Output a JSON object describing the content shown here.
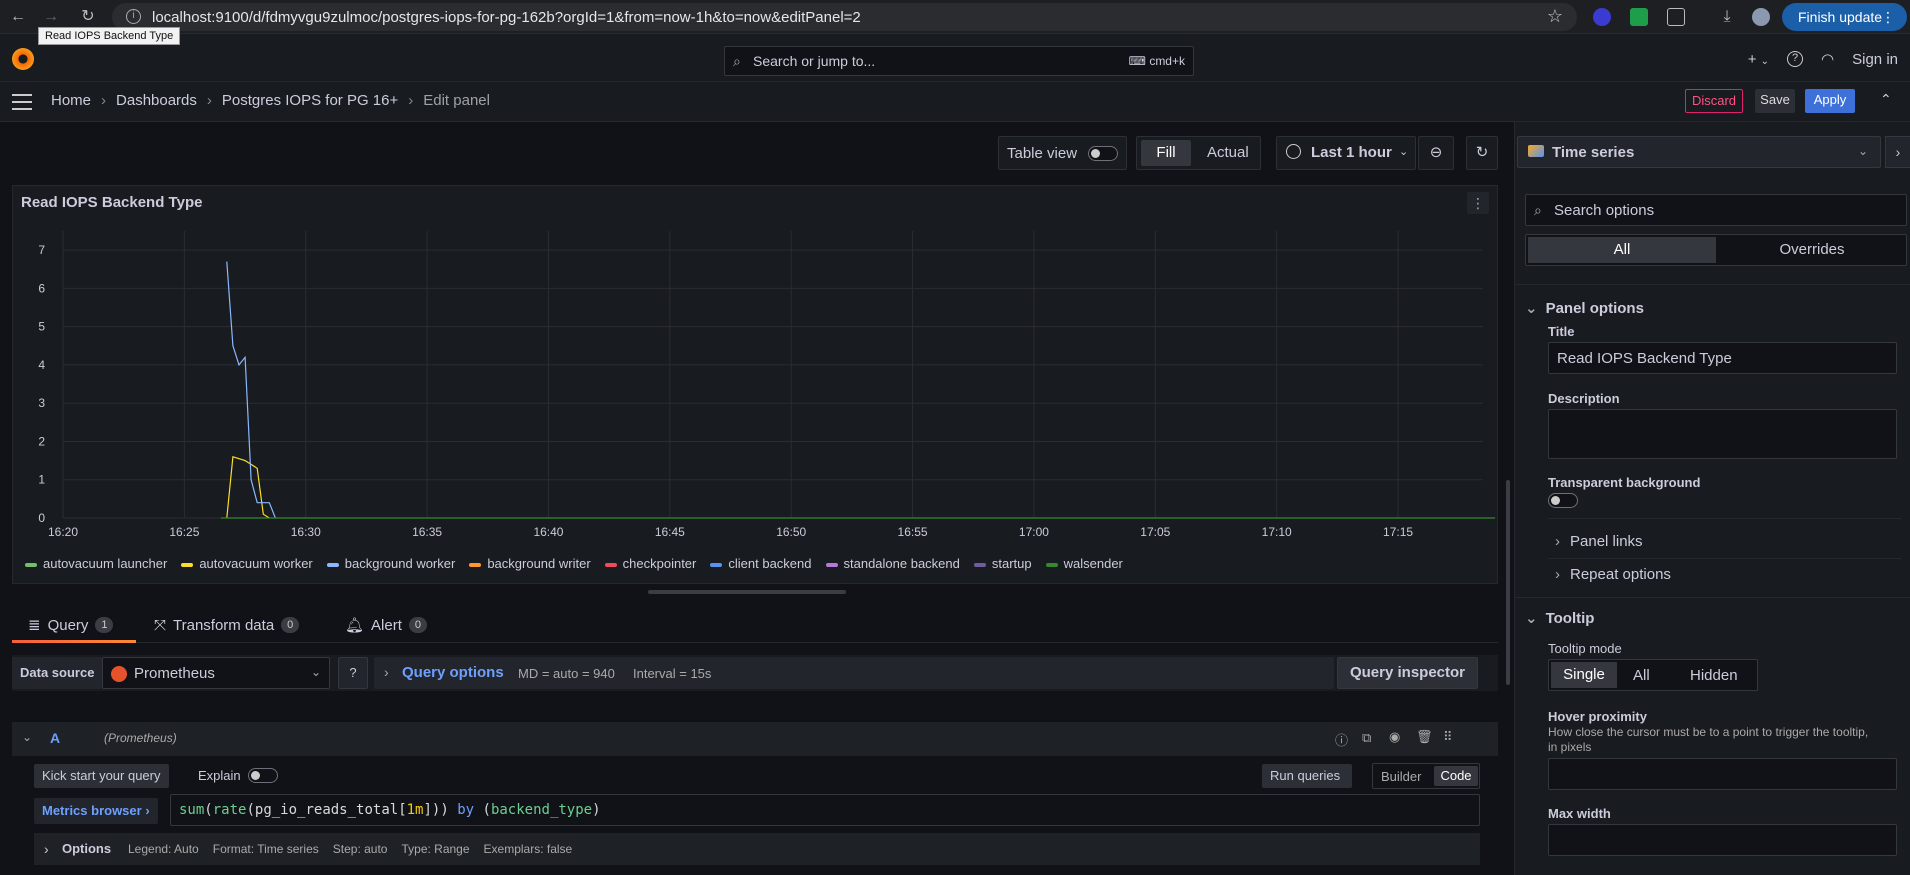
{
  "browser": {
    "url": "localhost:9100/d/fdmyvgu9zulmoc/postgres-iops-for-pg-162b?orgId=1&from=now-1h&to=now&editPanel=2",
    "tooltip": "Read IOPS Backend Type",
    "finish_update": "Finish update"
  },
  "topnav": {
    "search_placeholder": "Search or jump to...",
    "shortcut": "cmd+k",
    "plus": "+",
    "sign_in": "Sign in"
  },
  "breadcrumb": [
    "Home",
    "Dashboards",
    "Postgres IOPS for PG 16+",
    "Edit panel"
  ],
  "toolbar": {
    "discard": "Discard",
    "save": "Save",
    "apply": "Apply",
    "accent_discard": "#e0226e",
    "accent_apply": "#3d71d9"
  },
  "panel_controls": {
    "table_view": "Table view",
    "fill": "Fill",
    "actual": "Actual",
    "time_range": "Last 1 hour"
  },
  "panel": {
    "title": "Read IOPS Backend Type"
  },
  "chart_data": {
    "type": "line",
    "x_ticks": [
      "16:20",
      "16:25",
      "16:30",
      "16:35",
      "16:40",
      "16:45",
      "16:50",
      "16:55",
      "17:00",
      "17:05",
      "17:10",
      "17:15"
    ],
    "y_ticks": [
      0,
      1,
      2,
      3,
      4,
      5,
      6,
      7
    ],
    "ylim": [
      0,
      7.5
    ],
    "grid": true,
    "legend_placement": "bottom",
    "series": [
      {
        "name": "autovacuum launcher",
        "color": "#73bf69",
        "points": []
      },
      {
        "name": "autovacuum worker",
        "color": "#fade2a",
        "points": [
          [
            "16:26:45",
            0
          ],
          [
            "16:27:00",
            1.6
          ],
          [
            "16:27:30",
            1.5
          ],
          [
            "16:27:45",
            1.4
          ],
          [
            "16:28:00",
            1.3
          ],
          [
            "16:28:15",
            0.1
          ],
          [
            "16:28:30",
            0
          ]
        ]
      },
      {
        "name": "background worker",
        "color": "#8ab8ff",
        "points": [
          [
            "16:26:45",
            6.7
          ],
          [
            "16:27:00",
            4.5
          ],
          [
            "16:27:15",
            4.0
          ],
          [
            "16:27:30",
            4.2
          ],
          [
            "16:27:45",
            1.0
          ],
          [
            "16:28:00",
            0.4
          ],
          [
            "16:28:30",
            0.4
          ],
          [
            "16:28:45",
            0
          ]
        ]
      },
      {
        "name": "background writer",
        "color": "#ff9830",
        "points": []
      },
      {
        "name": "checkpointer",
        "color": "#f2495c",
        "points": []
      },
      {
        "name": "client backend",
        "color": "#5794f2",
        "points": []
      },
      {
        "name": "standalone backend",
        "color": "#b877d9",
        "points": []
      },
      {
        "name": "startup",
        "color": "#705da0",
        "points": []
      },
      {
        "name": "walsender",
        "color": "#37872d",
        "points": [
          [
            "16:26:30",
            0
          ],
          [
            "17:19:00",
            0
          ]
        ]
      }
    ]
  },
  "query_tabs": [
    {
      "label": "Query",
      "count": "1"
    },
    {
      "label": "Transform data",
      "count": "0"
    },
    {
      "label": "Alert",
      "count": "0"
    }
  ],
  "datasource": {
    "label": "Data source",
    "value": "Prometheus",
    "query_options": "Query options",
    "md": "MD = auto = 940",
    "interval": "Interval = 15s",
    "inspector": "Query inspector"
  },
  "query": {
    "ref": "A",
    "ds": "(Prometheus)",
    "kick_start": "Kick start your query",
    "explain": "Explain",
    "run": "Run queries",
    "builder": "Builder",
    "code": "Code",
    "metrics_browser": "Metrics browser",
    "expr_parts": [
      "sum",
      "(",
      "rate",
      "(",
      "pg_io_reads_total",
      "[",
      "1m",
      "]",
      ")",
      ")",
      " by ",
      "(",
      "backend_type",
      ")"
    ],
    "options_label": "Options",
    "options_summary": [
      "Legend: Auto",
      "Format: Time series",
      "Step: auto",
      "Type: Range",
      "Exemplars: false"
    ]
  },
  "right_pane": {
    "viz": "Time series",
    "search_placeholder": "Search options",
    "tab_all": "All",
    "tab_overrides": "Overrides",
    "panel_options": "Panel options",
    "title_label": "Title",
    "title_value": "Read IOPS Backend Type",
    "description_label": "Description",
    "transparent_label": "Transparent background",
    "panel_links": "Panel links",
    "repeat_options": "Repeat options",
    "tooltip_section": "Tooltip",
    "tooltip_mode_label": "Tooltip mode",
    "tooltip_modes": [
      "Single",
      "All",
      "Hidden"
    ],
    "hover_label": "Hover proximity",
    "hover_desc": "How close the cursor must be to a point to trigger the tooltip, in pixels",
    "max_width_label": "Max width"
  }
}
